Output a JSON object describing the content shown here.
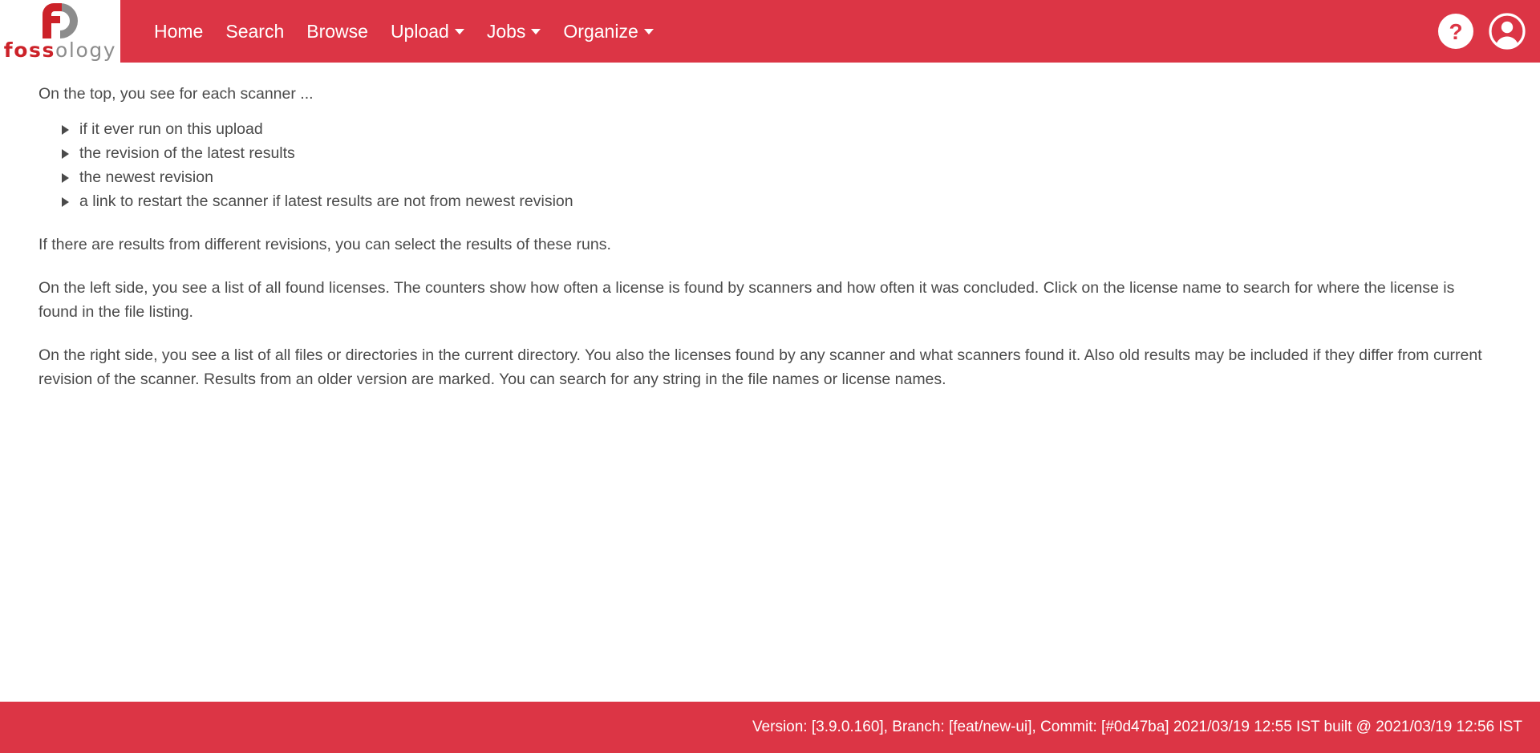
{
  "theme": {
    "brand_red": "#dc3545",
    "logo_red": "#cc2229",
    "logo_gray": "#8c8c8c",
    "body_text": "#4a4a4a",
    "page_background": "#ffffff"
  },
  "navbar": {
    "logo": {
      "word_red": "foss",
      "word_gray": "ology",
      "alt": "fossology-logo"
    },
    "items": [
      {
        "label": "Home",
        "has_caret": false
      },
      {
        "label": "Search",
        "has_caret": false
      },
      {
        "label": "Browse",
        "has_caret": false
      },
      {
        "label": "Upload",
        "has_caret": true
      },
      {
        "label": "Jobs",
        "has_caret": true
      },
      {
        "label": "Organize",
        "has_caret": true
      }
    ],
    "right_icons": [
      {
        "name": "help-icon",
        "glyph": "?"
      },
      {
        "name": "user-account-icon",
        "glyph": "person"
      }
    ]
  },
  "main": {
    "intro": "On the top, you see for each scanner ...",
    "bullets": [
      "if it ever run on this upload",
      "the revision of the latest results",
      "the newest revision",
      "a link to restart the scanner if latest results are not from newest revision"
    ],
    "paragraph_revisions": "If there are results from different revisions, you can select the results of these runs.",
    "paragraph_left_side": "On the left side, you see a list of all found licenses. The counters show how often a license is found by scanners and how often it was concluded. Click on the license name to search for where the license is found in the file listing.",
    "paragraph_right_side": "On the right side, you see a list of all files or directories in the current directory. You also the licenses found by any scanner and what scanners found it. Also old results may be included if they differ from current revision of the scanner. Results from an older version are marked. You can search for any string in the file names or license names."
  },
  "footer": {
    "version_text": "Version: [3.9.0.160], Branch: [feat/new-ui], Commit: [#0d47ba] 2021/03/19 12:55 IST built @ 2021/03/19 12:56 IST"
  }
}
